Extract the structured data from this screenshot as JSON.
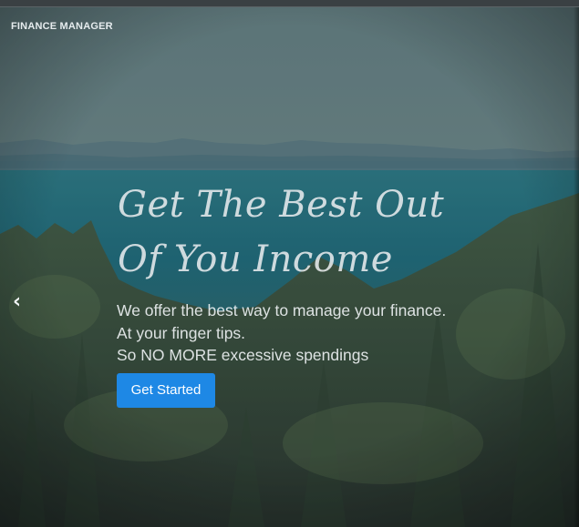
{
  "brand": {
    "label": "FINANCE MANAGER",
    "color": "#e6ecee"
  },
  "hero": {
    "headline_lines": [
      "Get The Best Out",
      "Of You Income"
    ],
    "description_lines": [
      "We offer the best way to manage your finance.",
      "At your finger tips.",
      "So NO MORE excessive spendings"
    ],
    "cta_label": "Get Started",
    "cta_color": "#1e88e5",
    "prev_icon": "chevron-left-icon",
    "prev_glyph": "‹"
  },
  "colors": {
    "sky": "#6f8f93",
    "water": "#2a7a8a",
    "mountains": "#5f7d8a",
    "forest": "#3f5a43"
  }
}
